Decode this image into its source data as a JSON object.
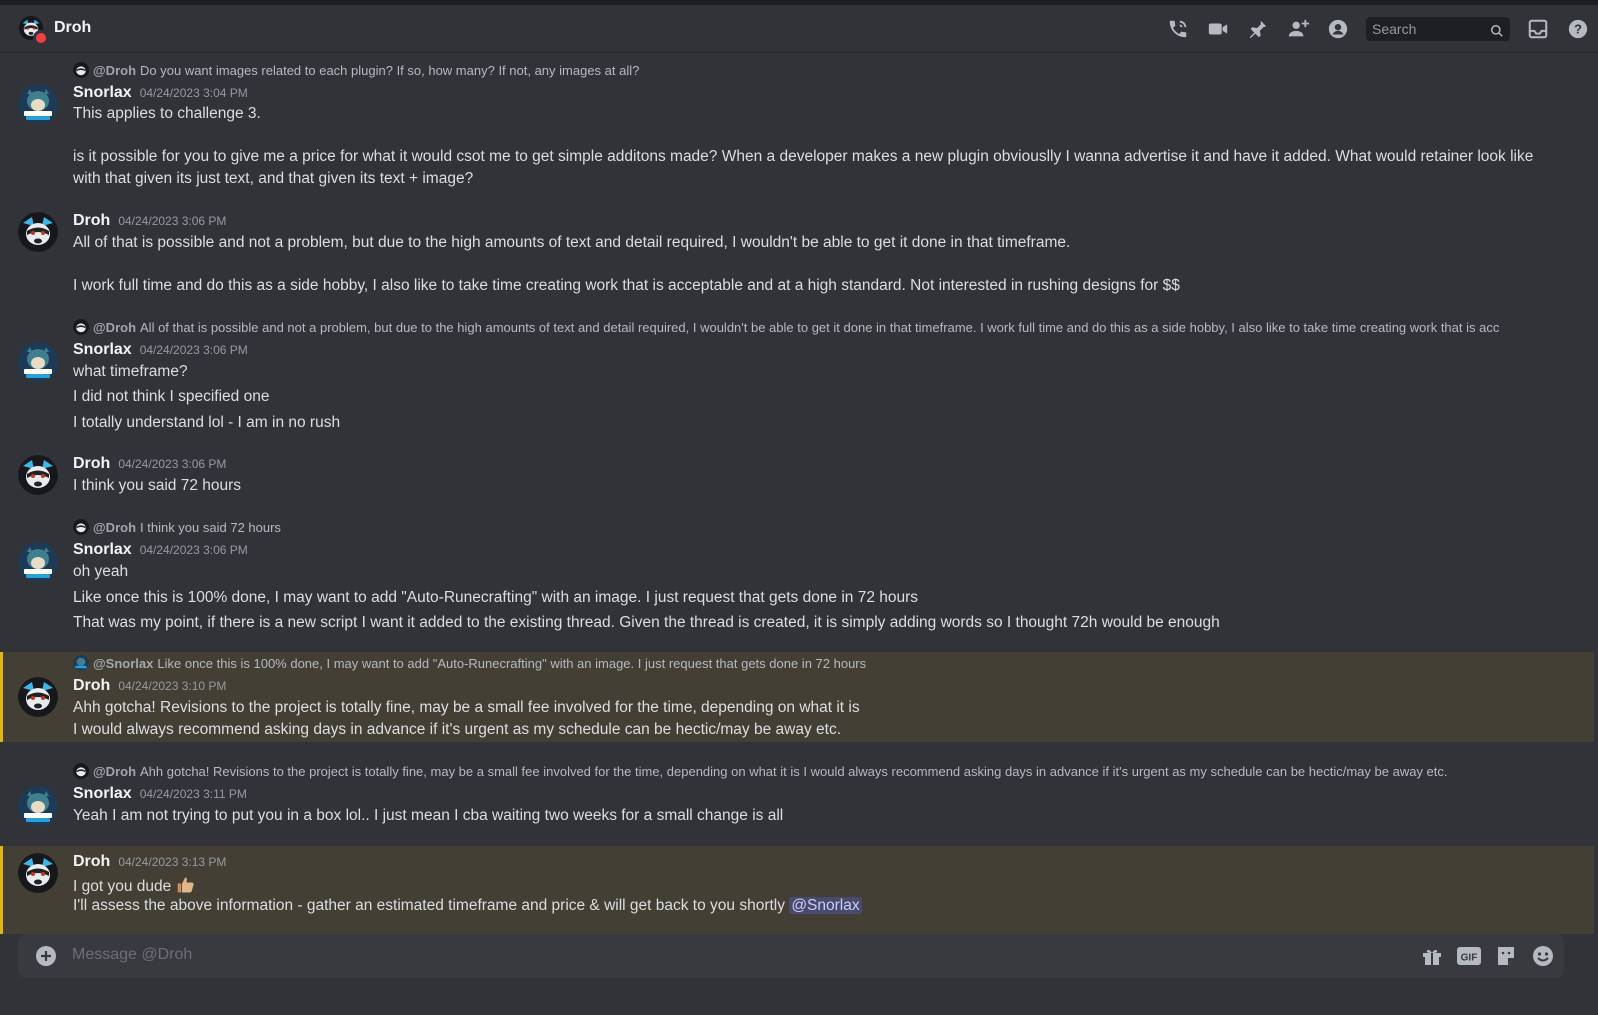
{
  "header": {
    "dm_name": "Droh",
    "search_placeholder": "Search"
  },
  "icons": {
    "toolbar": [
      "voice-call-icon",
      "video-call-icon",
      "pin-icon",
      "add-friend-icon",
      "user-profile-icon",
      "search-icon",
      "inbox-icon",
      "help-icon"
    ],
    "composer": [
      "add-attachment-icon",
      "gift-icon",
      "gif-icon",
      "sticker-icon",
      "emoji-icon"
    ]
  },
  "messages": [
    {
      "reply": {
        "author": "@Droh",
        "text": "Do you want images related to each plugin? If so, how many? If not, any images at all?"
      },
      "author": "Snorlax",
      "timestamp": "04/24/2023 3:04 PM",
      "lines": [
        "This applies to challenge 3.",
        "is it possible for you to give me a price for what it would csot me to get simple additons made? When a developer makes a new plugin obviouslly I wanna advertise it and have it added. What would retainer look like with that given its just text, and that given its text + image?"
      ]
    },
    {
      "author": "Droh",
      "timestamp": "04/24/2023 3:06 PM",
      "lines": [
        "All of that is possible and not a problem, but due to the high amounts of text and detail required, I wouldn't be able to get it done in that timeframe.",
        "I work full time and do this as a side hobby, I also like to take time creating work that is acceptable and at a high standard. Not interested in rushing designs for $$"
      ]
    },
    {
      "reply": {
        "author": "@Droh",
        "text": "All of that is possible and not a problem, but due to the high amounts of text and detail required, I wouldn't be able to get it done in that timeframe. I work full time and do this as a side hobby, I also like to take time creating work that is acc"
      },
      "author": "Snorlax",
      "timestamp": "04/24/2023 3:06 PM",
      "lines": [
        "what timeframe?",
        "I did not think I specified one",
        "I totally understand lol - I am in no rush"
      ]
    },
    {
      "author": "Droh",
      "timestamp": "04/24/2023 3:06 PM",
      "lines": [
        "I think you said 72 hours"
      ]
    },
    {
      "reply": {
        "author": "@Droh",
        "text": "I think you said 72 hours"
      },
      "author": "Snorlax",
      "timestamp": "04/24/2023 3:06 PM",
      "lines": [
        "oh yeah",
        "Like once this is 100% done, I may want to add \"Auto-Runecrafting\" with an image. I just request that gets done in 72 hours",
        "That was my point, if there is a new script I want it added to the existing thread. Given the thread is created, it is simply adding words so I thought 72h would be enough"
      ]
    },
    {
      "reply": {
        "author": "@Snorlax",
        "text": "Like once this is 100% done, I may want to add \"Auto-Runecrafting\" with an image. I just request that gets done in 72 hours"
      },
      "author": "Droh",
      "timestamp": "04/24/2023 3:10 PM",
      "lines": [
        "Ahh gotcha! Revisions to the project is totally fine, may be a small fee involved for the time, depending on what it is",
        "I would always recommend asking days in advance if it's urgent as my schedule can be hectic/may be away etc."
      ]
    },
    {
      "reply": {
        "author": "@Droh",
        "text": "Ahh gotcha! Revisions to the project is totally fine, may be a small fee involved for the time, depending on what it is I would always recommend asking days in advance if it's urgent as my schedule can be hectic/may be away etc."
      },
      "author": "Snorlax",
      "timestamp": "04/24/2023 3:11 PM",
      "lines": [
        "Yeah I am not trying to put you in a box lol.. I just mean I cba waiting two weeks for a small change is all"
      ]
    },
    {
      "author": "Droh",
      "timestamp": "04/24/2023 3:13 PM",
      "lines": [
        "I got you dude",
        "I'll assess the above information - gather an estimated timeframe and price & will get back to you shortly"
      ],
      "mention": "@Snorlax",
      "emoji": "thumbs-up"
    }
  ],
  "composer": {
    "placeholder": "Message @Droh",
    "gif_label": "GIF"
  },
  "colors": {
    "background": "#313338",
    "highlight": "#433f34",
    "highlight_bar": "#e2b714",
    "mention_bg": "#5865f2",
    "dnd_status": "#f23f43"
  }
}
